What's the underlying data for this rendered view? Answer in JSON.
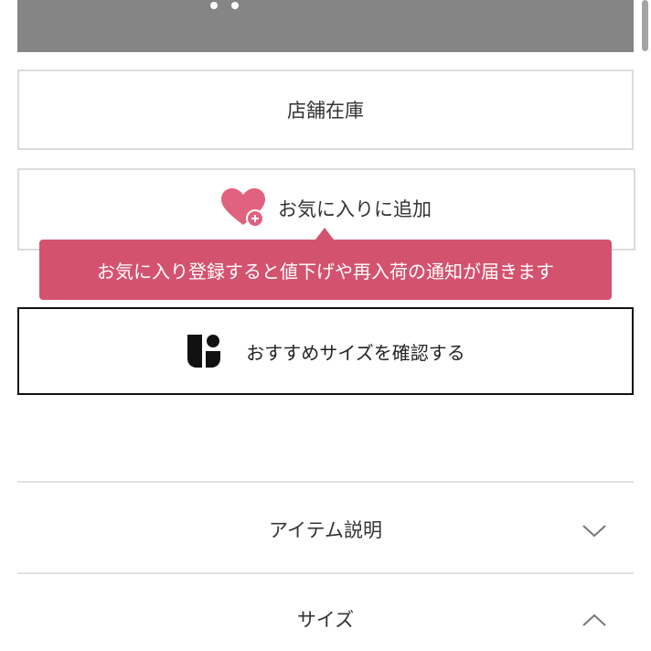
{
  "buttons": {
    "store_stock": "店舗在庫",
    "add_favorite": "お気に入りに追加",
    "recommend_size": "おすすめサイズを確認する"
  },
  "tooltip": {
    "text": "お気に入り登録すると値下げや再入荷の通知が届きます"
  },
  "accordion": {
    "item_description": "アイテム説明",
    "size": "サイズ"
  },
  "colors": {
    "accent_pink": "#d3536f",
    "heart_pink": "#e0627e",
    "banner_gray": "#858585"
  },
  "icons": {
    "favorite": "heart-plus-icon",
    "recommend": "size-recommend-logo-icon",
    "collapsed": "chevron-down-icon",
    "expanded": "chevron-up-icon"
  }
}
